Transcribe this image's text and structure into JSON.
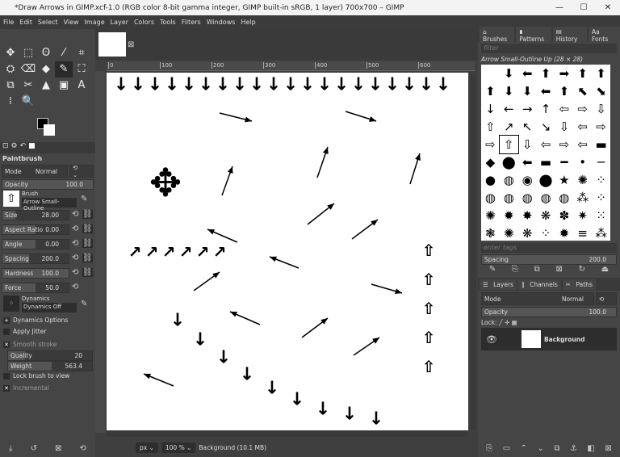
{
  "window": {
    "title": "*Draw Arrows in GIMP.xcf-1.0 (RGB color 8-bit gamma integer, GIMP built-in sRGB, 1 layer) 700x700 – GIMP"
  },
  "menu": [
    "File",
    "Edit",
    "Select",
    "View",
    "Image",
    "Layer",
    "Colors",
    "Tools",
    "Filters",
    "Windows",
    "Help"
  ],
  "tool_options": {
    "title": "Paintbrush",
    "mode_label": "Mode",
    "mode_value": "Normal",
    "opacity_label": "Opacity",
    "opacity_value": "100.0",
    "brush_label": "Brush",
    "brush_value": "Arrow Small-Outline",
    "params": [
      {
        "label": "Size",
        "value": "28.00",
        "fill": 0.2
      },
      {
        "label": "Aspect Ratio",
        "value": "0.00",
        "fill": 0.5
      },
      {
        "label": "Angle",
        "value": "0.00",
        "fill": 0.5
      },
      {
        "label": "Spacing",
        "value": "200.0",
        "fill": 0.4
      },
      {
        "label": "Hardness",
        "value": "100.0",
        "fill": 1.0
      },
      {
        "label": "Force",
        "value": "50.0",
        "fill": 0.5
      }
    ],
    "dynamics_label": "Dynamics",
    "dynamics_value": "Dynamics Off",
    "dynamics_options": "Dynamics Options",
    "apply_jitter": "Apply Jitter",
    "smooth_stroke": "Smooth stroke",
    "quality_label": "Quality",
    "quality_value": "20",
    "weight_label": "Weight",
    "weight_value": "563.4",
    "lock_brush": "Lock brush to view",
    "incremental": "Incremental"
  },
  "ruler": [
    "0",
    "100",
    "200",
    "300",
    "400",
    "500",
    "600"
  ],
  "status": {
    "unit": "px",
    "zoom": "100 %",
    "info": "Background (10.1 MB)"
  },
  "brushes_panel": {
    "tabs": [
      "Brushes",
      "Patterns",
      "History",
      "Fonts"
    ],
    "filter_placeholder": "filter",
    "selected": "Arrow Small-Outline Up (28 × 28)",
    "tags_placeholder": "enter tags",
    "spacing_label": "Spacing",
    "spacing_value": "200.0"
  },
  "layers_panel": {
    "tabs": [
      "Layers",
      "Channels",
      "Paths"
    ],
    "mode_label": "Mode",
    "mode_value": "Normal",
    "opacity_label": "Opacity",
    "opacity_value": "100.0",
    "lock_label": "Lock:",
    "layer_name": "Background"
  }
}
